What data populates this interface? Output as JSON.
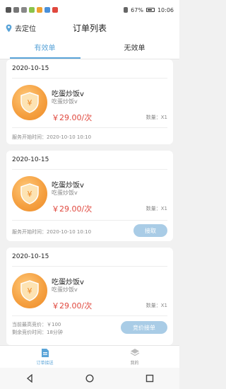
{
  "status_bar": {
    "battery": "67%",
    "time": "10:06"
  },
  "header": {
    "location_label": "去定位",
    "title": "订单列表"
  },
  "tabs": [
    {
      "label": "有效单",
      "active": true
    },
    {
      "label": "无效单",
      "active": false
    }
  ],
  "orders": [
    {
      "date": "2020-10-15",
      "name": "吃蛋炒饭v",
      "subname": "吃蛋炒饭v",
      "price": "￥29.00/次",
      "qty": "数量：X1",
      "footer_lines": [
        "服务开始时间：2020-10-10 10:10"
      ],
      "button": ""
    },
    {
      "date": "2020-10-15",
      "name": "吃蛋炒饭v",
      "subname": "吃蛋炒饭v",
      "price": "￥29.00/次",
      "qty": "数量：X1",
      "footer_lines": [
        "服务开始时间：2020-10-10 10:10"
      ],
      "button": "接取"
    },
    {
      "date": "2020-10-15",
      "name": "吃蛋炒饭v",
      "subname": "吃蛋炒饭v",
      "price": "￥29.00/次",
      "qty": "数量：X1",
      "footer_lines": [
        "当前最高竞价：￥100",
        "剩余竞价时间：18分钟"
      ],
      "button": "竞价接单"
    }
  ],
  "bottom_nav": [
    {
      "label": "订单接送",
      "icon": "order-doc-icon",
      "active": true
    },
    {
      "label": "我的",
      "icon": "layers-icon",
      "active": false
    }
  ],
  "colors": {
    "accent": "#5aa4d8",
    "price": "#e0483e",
    "button": "#a9cce6",
    "shield": "#f5a142"
  }
}
